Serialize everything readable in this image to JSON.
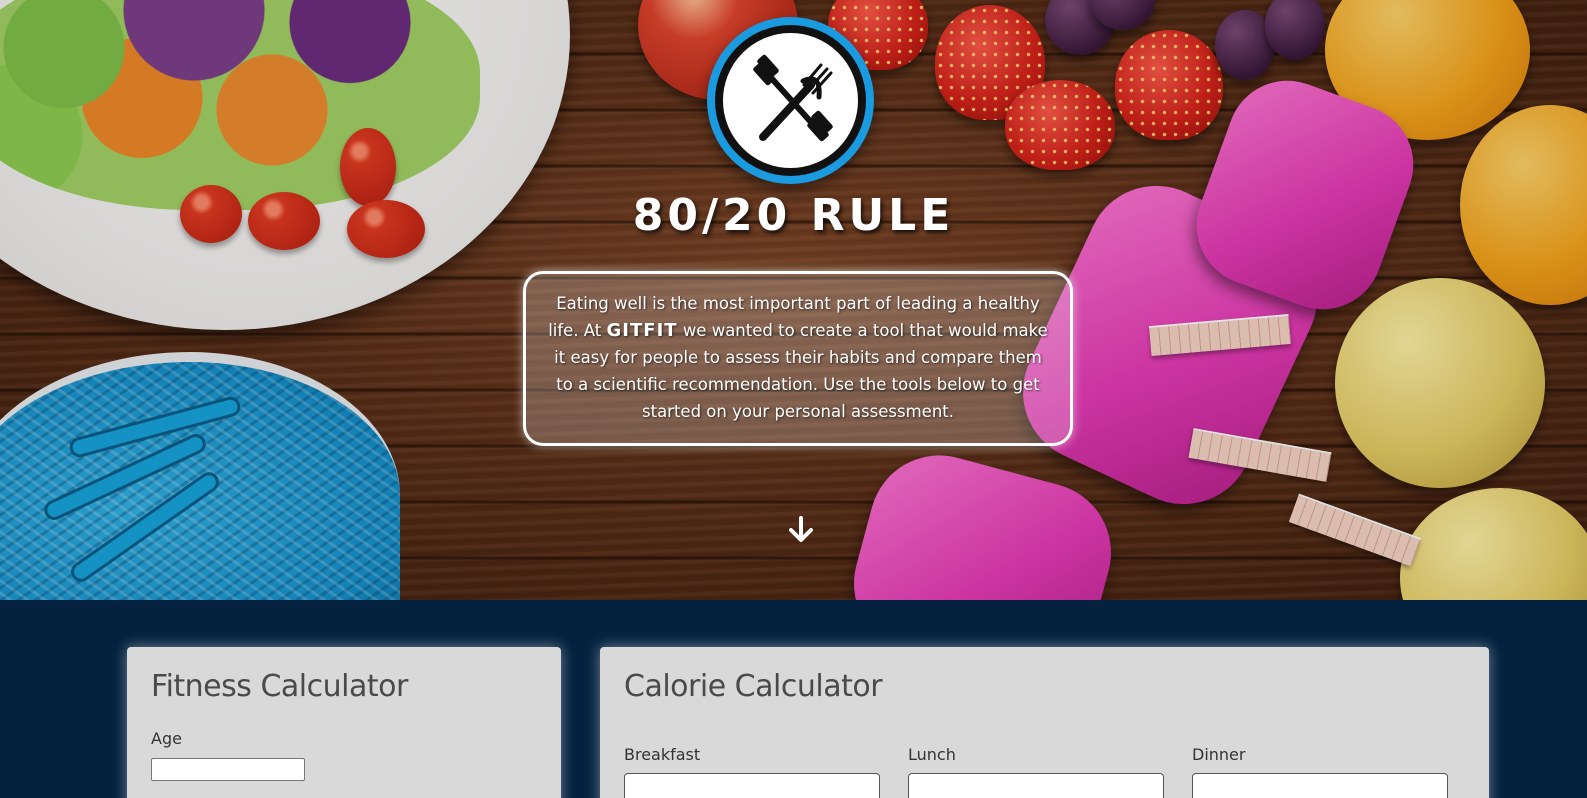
{
  "hero": {
    "title": "80/20 RULE",
    "intro_before": "Eating well is the most important part of leading a healthy life. At",
    "brand": "GITFIT",
    "intro_after": "we wanted to create a tool that would make it easy for people to assess their habits and compare them to a scientific recommendation. Use the tools below to get started on your personal assessment.",
    "logo_icon": "dumbbell-fork-cross-icon",
    "scroll_icon": "arrow-down-icon"
  },
  "fitness": {
    "title": "Fitness Calculator",
    "age_label": "Age",
    "age_value": ""
  },
  "calorie": {
    "title": "Calorie Calculator",
    "meals": [
      {
        "label": "Breakfast",
        "value": ""
      },
      {
        "label": "Lunch",
        "value": ""
      },
      {
        "label": "Dinner",
        "value": ""
      }
    ]
  },
  "colors": {
    "section_bg": "#04223f",
    "card_bg": "#d9d9d9",
    "logo_ring": "#1a9be0"
  }
}
